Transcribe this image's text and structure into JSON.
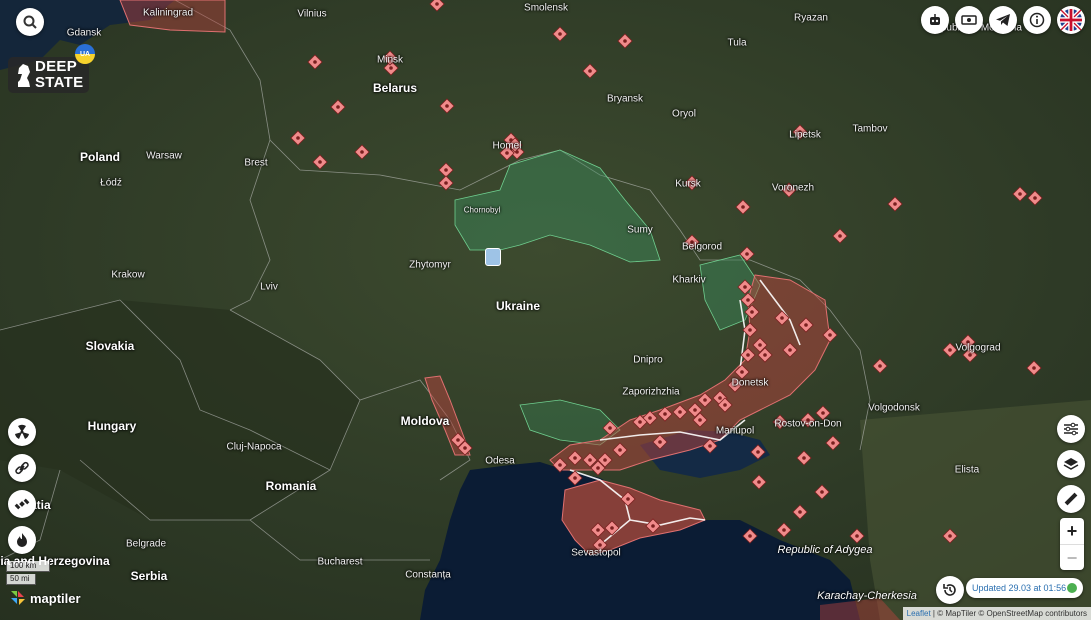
{
  "map_labels": {
    "countries": [
      {
        "name": "Belarus"
      },
      {
        "name": "Poland"
      },
      {
        "name": "Ukraine"
      },
      {
        "name": "Slovakia"
      },
      {
        "name": "Hungary"
      },
      {
        "name": "Moldova"
      },
      {
        "name": "Romania"
      },
      {
        "name": "Serbia"
      },
      {
        "name": "Bosnia and Herzegovina"
      },
      {
        "name": "Croatia"
      }
    ],
    "cities": [
      {
        "name": "Kaliningrad"
      },
      {
        "name": "Gdansk"
      },
      {
        "name": "Vilnius"
      },
      {
        "name": "Smolensk"
      },
      {
        "name": "Ryazan"
      },
      {
        "name": "Tula"
      },
      {
        "name": "Minsk"
      },
      {
        "name": "Bryansk"
      },
      {
        "name": "Oryol"
      },
      {
        "name": "Lipetsk"
      },
      {
        "name": "Tambov"
      },
      {
        "name": "Warsaw"
      },
      {
        "name": "Brest"
      },
      {
        "name": "Homel"
      },
      {
        "name": "Łódź"
      },
      {
        "name": "Kursk"
      },
      {
        "name": "Voronezh"
      },
      {
        "name": "Chornobyl"
      },
      {
        "name": "Sumy"
      },
      {
        "name": "Belgorod"
      },
      {
        "name": "Krakow"
      },
      {
        "name": "Zhytomyr"
      },
      {
        "name": "Kharkiv"
      },
      {
        "name": "Lviv"
      },
      {
        "name": "Volgograd"
      },
      {
        "name": "Dnipro"
      },
      {
        "name": "Zaporizhzhia"
      },
      {
        "name": "Donetsk"
      },
      {
        "name": "Rostov-on-Don"
      },
      {
        "name": "Volgodonsk"
      },
      {
        "name": "Mariupol"
      },
      {
        "name": "Cluj-Napoca"
      },
      {
        "name": "Odesa"
      },
      {
        "name": "Elista"
      },
      {
        "name": "Belgrade"
      },
      {
        "name": "Bucharest"
      },
      {
        "name": "Constanța"
      },
      {
        "name": "Sevastopol"
      },
      {
        "name": "Republic of Mordovia"
      }
    ],
    "regions": [
      {
        "name": "Republic of Adygea"
      },
      {
        "name": "Karachay-Cherkesia"
      }
    ]
  },
  "branding": {
    "logo_line1": "DEEP",
    "logo_line2": "STATE",
    "ua_badge": "UA",
    "tiles": "maptiler"
  },
  "top_bar": {
    "icons": [
      "robot-icon",
      "cash-icon",
      "telegram-icon",
      "info-icon",
      "uk-flag-icon"
    ],
    "search_icon": "search-icon"
  },
  "left_tools": [
    "radiation-icon",
    "link-icon",
    "satellite-icon",
    "fire-icon"
  ],
  "right_tools": [
    "filter-sliders-icon",
    "layers-icon",
    "ruler-icon"
  ],
  "zoom": {
    "in": "+",
    "out": "−"
  },
  "status": {
    "updated": "Updated 29.03 at 01:56",
    "status_color": "#4caf50"
  },
  "scale": {
    "metric": "100 km",
    "imperial": "50 mi"
  },
  "attribution": {
    "leaflet": "Leaflet",
    "sep": " | ",
    "rest": "© MapTiler © OpenStreetMap contributors"
  },
  "colors": {
    "occupied": "#b8433e",
    "liberated": "#3c8b5d",
    "marker": "#f08b8b",
    "water": "#0b1c34"
  }
}
